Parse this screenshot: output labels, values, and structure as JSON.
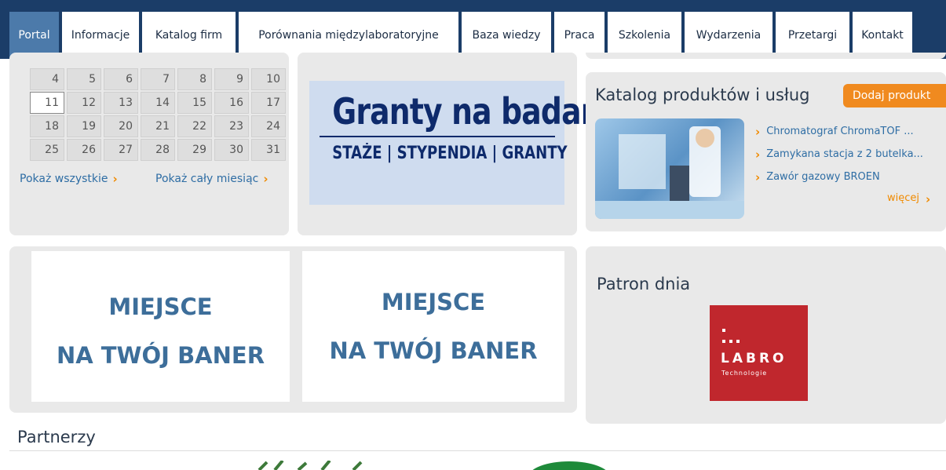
{
  "nav": {
    "items": [
      {
        "label": "Portal",
        "active": true,
        "width": 63
      },
      {
        "label": "Informacje",
        "width": 98
      },
      {
        "label": "Katalog firm",
        "width": 119
      },
      {
        "label": "Porównania międzylaboratoryjne",
        "width": 280
      },
      {
        "label": "Baza wiedzy",
        "width": 114
      },
      {
        "label": "Praca",
        "width": 64
      },
      {
        "label": "Szkolenia",
        "width": 94
      },
      {
        "label": "Wydarzenia",
        "width": 112
      },
      {
        "label": "Przetargi",
        "width": 94
      },
      {
        "label": "Kontakt",
        "width": 76
      }
    ]
  },
  "calendar": {
    "weeks": [
      [
        "4",
        "5",
        "6",
        "7",
        "8",
        "9",
        "10"
      ],
      [
        "11",
        "12",
        "13",
        "14",
        "15",
        "16",
        "17"
      ],
      [
        "18",
        "19",
        "20",
        "21",
        "22",
        "23",
        "24"
      ],
      [
        "25",
        "26",
        "27",
        "28",
        "29",
        "30",
        "31"
      ]
    ],
    "today": "11",
    "show_all": "Pokaż wszystkie",
    "show_month": "Pokaż cały miesiąc"
  },
  "granty": {
    "title": "Granty na badania",
    "subtitle": "STAŻE | STYPENDIA | GRANTY"
  },
  "catalog": {
    "title": "Katalog produktów i usług",
    "add_button": "Dodaj produkt",
    "items": [
      "Chromatograf ChromaTOF ...",
      "Zamykana stacja z 2 butelka...",
      "Zawór gazowy BROEN"
    ],
    "more": "więcej"
  },
  "banners": {
    "line1": "MIEJSCE",
    "line2": "NA TWÓJ BANER"
  },
  "patron": {
    "title": "Patron dnia",
    "logo_name": "LABRO",
    "logo_sub": "Technologie"
  },
  "partners": {
    "title": "Partnerzy"
  },
  "colors": {
    "nav_bg": "#1b3d68",
    "nav_active": "#4c7aaa",
    "accent_orange": "#f08a1f",
    "link_blue": "#2e6da4",
    "labro_red": "#c0272d"
  }
}
